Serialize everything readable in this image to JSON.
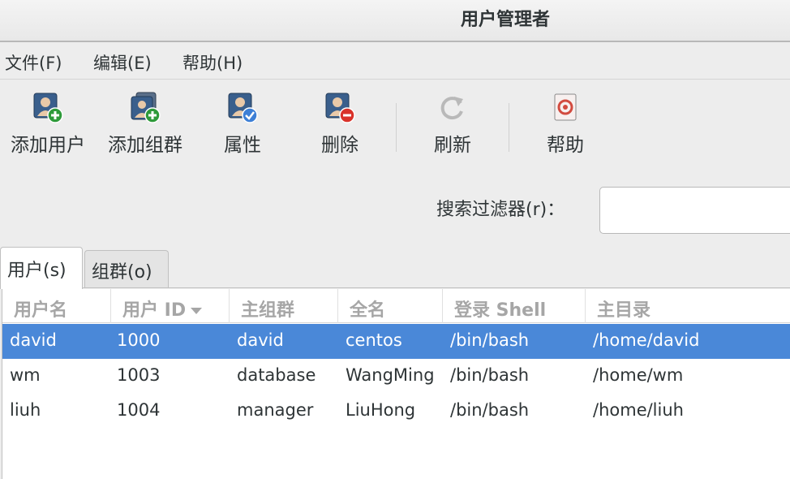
{
  "window": {
    "title": "用户管理者"
  },
  "menu": [
    {
      "label": "文件(F)"
    },
    {
      "label": "编辑(E)"
    },
    {
      "label": "帮助(H)"
    }
  ],
  "toolbar": {
    "add_user": "添加用户",
    "add_group": "添加组群",
    "properties": "属性",
    "delete": "删除",
    "refresh": "刷新",
    "help": "帮助"
  },
  "search": {
    "label": "搜索过滤器(r)：",
    "value": ""
  },
  "tabs": [
    {
      "label": "用户(s)",
      "active": true
    },
    {
      "label": "组群(o)",
      "active": false
    }
  ],
  "table": {
    "columns": [
      "用户名",
      "用户 ID",
      "主组群",
      "全名",
      "登录 Shell",
      "主目录"
    ],
    "sorted_column": "用户 ID",
    "rows": [
      {
        "name": "david",
        "uid": "1000",
        "group": "david",
        "fullname": "centos",
        "shell": "/bin/bash",
        "home": "/home/david",
        "selected": true
      },
      {
        "name": "wm",
        "uid": "1003",
        "group": "database",
        "fullname": "WangMing",
        "shell": "/bin/bash",
        "home": "/home/wm",
        "selected": false
      },
      {
        "name": "liuh",
        "uid": "1004",
        "group": "manager",
        "fullname": "LiuHong",
        "shell": "/bin/bash",
        "home": "/home/liuh",
        "selected": false
      }
    ]
  },
  "colors": {
    "selection": "#4a88d8",
    "add_badge": "#2e9a3a",
    "delete_badge": "#d9322a",
    "properties_badge": "#3d7fd6"
  }
}
